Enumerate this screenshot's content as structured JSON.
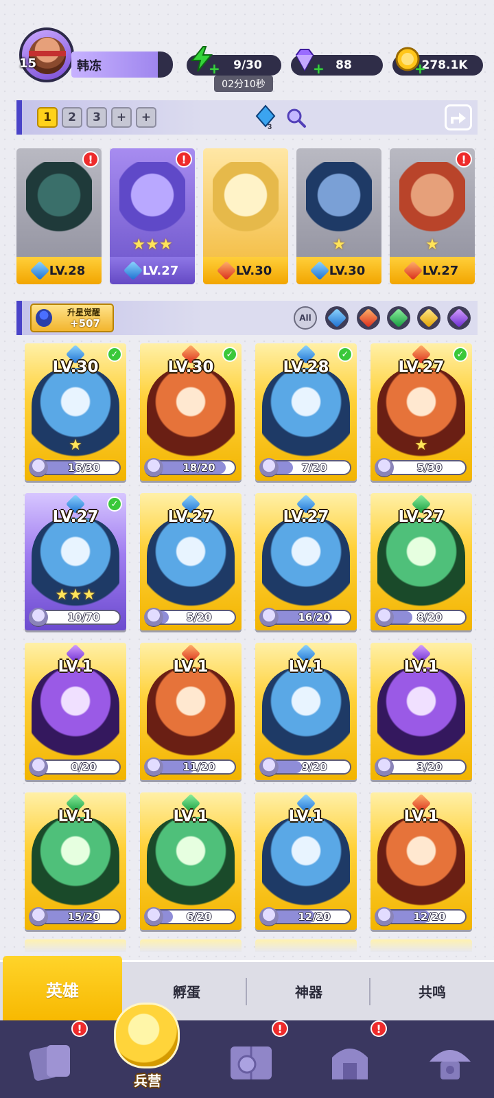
{
  "player": {
    "level": "15",
    "name": "韩冻"
  },
  "resources": {
    "energy": {
      "icon": "lightning-icon",
      "value": "9/30",
      "timer": "02分10秒"
    },
    "gems": {
      "icon": "diamond-icon",
      "value": "88"
    },
    "coins": {
      "icon": "coin-icon",
      "value": "278.1K"
    }
  },
  "team": {
    "slots": [
      "1",
      "2",
      "3",
      "+",
      "+"
    ],
    "active_slot": "1",
    "crystal_count": "3",
    "members": [
      {
        "level": "LV.28",
        "element": "water",
        "alert": "!"
      },
      {
        "level": "LV.27",
        "element": "water",
        "alert": "!",
        "stars": "★★★"
      },
      {
        "level": "LV.30",
        "element": "fire"
      },
      {
        "level": "LV.30",
        "element": "water",
        "stars": "★"
      },
      {
        "level": "LV.27",
        "element": "fire",
        "alert": "!",
        "stars": "★"
      }
    ]
  },
  "awaken": {
    "label": "升星觉醒",
    "count": "+507"
  },
  "filters": {
    "all_label": "All",
    "elements": [
      "water",
      "fire",
      "wind",
      "light",
      "dark"
    ]
  },
  "heroes": [
    {
      "level": "LV.30",
      "element": "water",
      "checked": true,
      "shards": "16/30",
      "progress": 0.53,
      "frame": "gold",
      "stars": "★"
    },
    {
      "level": "LV.30",
      "element": "fire",
      "checked": true,
      "shards": "18/20",
      "progress": 0.9,
      "frame": "gold"
    },
    {
      "level": "LV.28",
      "element": "water",
      "checked": true,
      "shards": "7/20",
      "progress": 0.35,
      "frame": "gold"
    },
    {
      "level": "LV.27",
      "element": "fire",
      "checked": true,
      "shards": "5/30",
      "progress": 0.17,
      "frame": "gold",
      "stars": "★"
    },
    {
      "level": "LV.27",
      "element": "water",
      "checked": true,
      "shards": "10/70",
      "progress": 0.14,
      "frame": "purple",
      "stars": "★★★"
    },
    {
      "level": "LV.27",
      "element": "water",
      "checked": false,
      "shards": "5/20",
      "progress": 0.25,
      "frame": "gold"
    },
    {
      "level": "LV.27",
      "element": "water",
      "checked": false,
      "shards": "16/20",
      "progress": 0.8,
      "frame": "gold"
    },
    {
      "level": "LV.27",
      "element": "wind",
      "checked": false,
      "shards": "8/20",
      "progress": 0.4,
      "frame": "gold"
    },
    {
      "level": "LV.1",
      "element": "dark",
      "checked": false,
      "shards": "0/20",
      "progress": 0.0,
      "frame": "gold"
    },
    {
      "level": "LV.1",
      "element": "fire",
      "checked": false,
      "shards": "11/20",
      "progress": 0.55,
      "frame": "gold"
    },
    {
      "level": "LV.1",
      "element": "water",
      "checked": false,
      "shards": "9/20",
      "progress": 0.45,
      "frame": "gold"
    },
    {
      "level": "LV.1",
      "element": "dark",
      "checked": false,
      "shards": "3/20",
      "progress": 0.15,
      "frame": "gold"
    },
    {
      "level": "LV.1",
      "element": "wind",
      "checked": false,
      "shards": "15/20",
      "progress": 0.75,
      "frame": "gold"
    },
    {
      "level": "LV.1",
      "element": "wind",
      "checked": false,
      "shards": "6/20",
      "progress": 0.3,
      "frame": "gold"
    },
    {
      "level": "LV.1",
      "element": "water",
      "checked": false,
      "shards": "12/20",
      "progress": 0.6,
      "frame": "gold"
    },
    {
      "level": "LV.1",
      "element": "fire",
      "checked": false,
      "shards": "12/20",
      "progress": 0.6,
      "frame": "gold"
    }
  ],
  "subtabs": [
    "英雄",
    "孵蛋",
    "神器",
    "共鸣"
  ],
  "nav": {
    "items": [
      {
        "name": "cards-icon",
        "alert": "!"
      },
      {
        "name": "barracks-icon",
        "label": "兵营"
      },
      {
        "name": "map-book-icon",
        "alert": "!"
      },
      {
        "name": "temple-icon",
        "alert": "!"
      },
      {
        "name": "mushroom-house-icon"
      }
    ]
  },
  "colors": {
    "accent": "#ffd21a",
    "nav_bg": "#3a3760",
    "alert": "#ee2b2b",
    "check": "#3ac83a"
  }
}
